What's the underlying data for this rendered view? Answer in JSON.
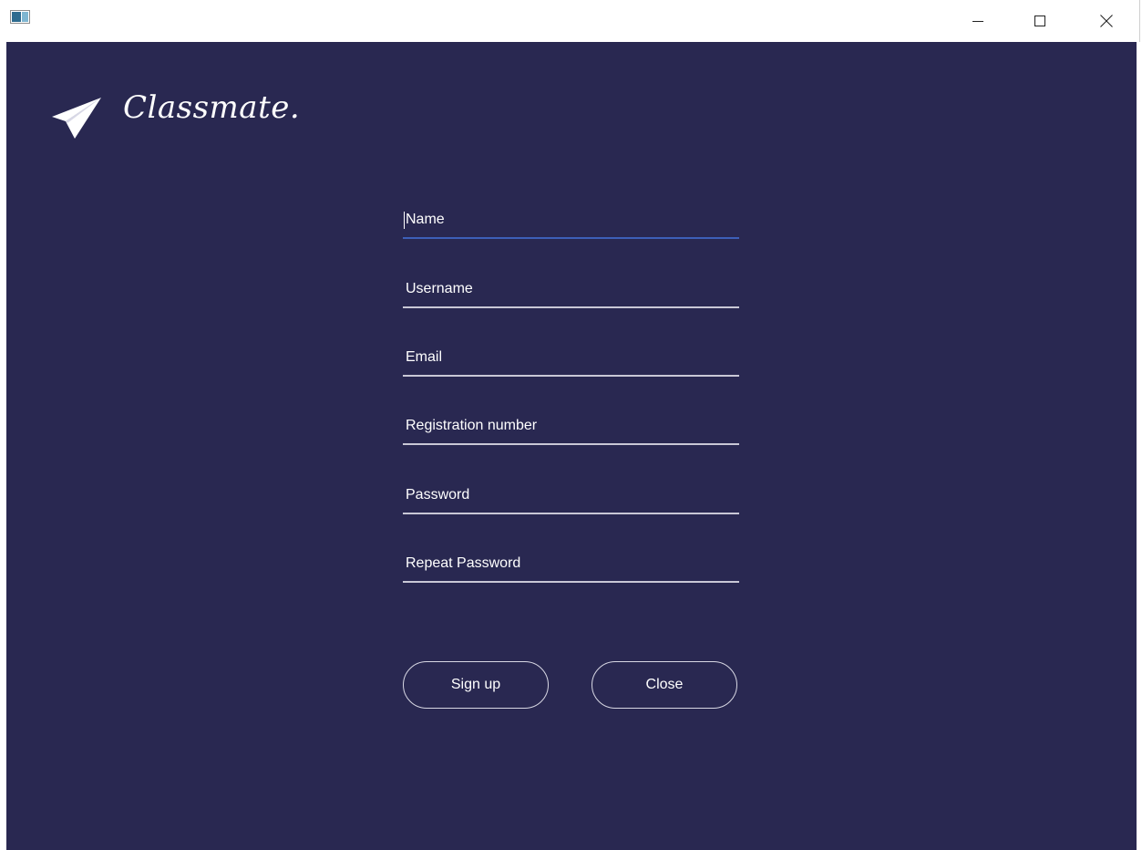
{
  "titlebar": {
    "icons": {
      "app": "app-window-icon",
      "minimize": "minimize-icon",
      "maximize": "maximize-icon",
      "close": "close-icon"
    }
  },
  "brand": {
    "name": "Classmate.",
    "icon": "paper-plane-icon",
    "background": "#292851"
  },
  "form": {
    "name_placeholder": "Name",
    "username_placeholder": "Username",
    "email_placeholder": "Email",
    "registration_placeholder": "Registration number",
    "password_placeholder": "Password",
    "repeat_password_placeholder": "Repeat Password",
    "focused_field": "Name",
    "focus_color": "#3d5fb8"
  },
  "actions": {
    "signup_label": "Sign up",
    "close_label": "Close"
  }
}
